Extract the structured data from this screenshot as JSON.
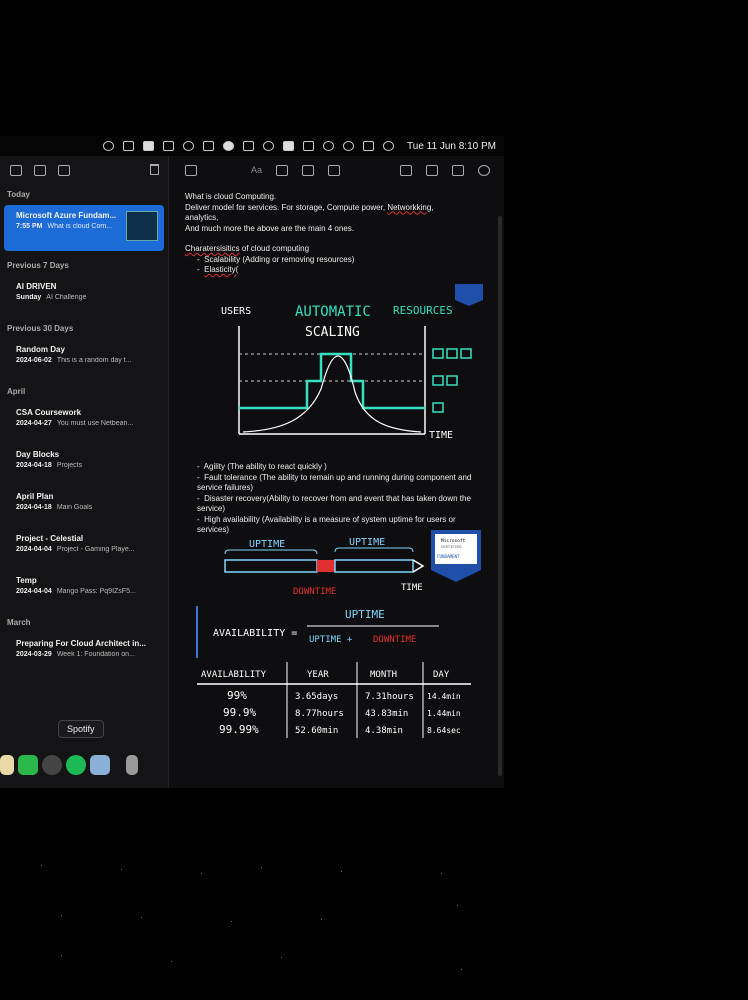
{
  "menubar": {
    "clock": "Tue 11 Jun  8:10 PM"
  },
  "sidebar": {
    "sections": [
      {
        "title": "Today",
        "notes": [
          {
            "title": "Microsoft Azure Fundam...",
            "date": "7:55 PM",
            "snippet": "What is cloud Com...",
            "active": true
          }
        ]
      },
      {
        "title": "Previous 7 Days",
        "notes": [
          {
            "title": "AI DRIVEN",
            "date": "Sunday",
            "snippet": "AI Challenge"
          }
        ]
      },
      {
        "title": "Previous 30 Days",
        "notes": [
          {
            "title": "Random Day",
            "date": "2024-06-02",
            "snippet": "This is a random day t..."
          }
        ]
      },
      {
        "title": "April",
        "notes": [
          {
            "title": "CSA Coursework",
            "date": "2024-04-27",
            "snippet": "You must use Netbean..."
          },
          {
            "title": "Day Blocks",
            "date": "2024-04-18",
            "snippet": "Projects"
          },
          {
            "title": "April Plan",
            "date": "2024-04-18",
            "snippet": "Main Goals"
          },
          {
            "title": "Project - Celestial",
            "date": "2024-04-04",
            "snippet": "Project - Gaming Playe..."
          },
          {
            "title": "Temp",
            "date": "2024-04-04",
            "snippet": "Mango Pass: Pq9IZsF5..."
          }
        ]
      },
      {
        "title": "March",
        "notes": [
          {
            "title": "Preparing For Cloud Architect in...",
            "date": "2024-03-29",
            "snippet": "Week 1: Foundation on..."
          }
        ]
      }
    ]
  },
  "tooltip": "Spotify",
  "editor": {
    "toolbar_text_style": "Aa",
    "lines1": [
      "What is cloud Computing.",
      "Deliver model for services. For storage, Compute power,",
      "Networkking,",
      "analytics,",
      "And much more the above are the main 4 ones."
    ],
    "characteristics_heading": "Charatersisitics",
    "characteristics_rest": " of cloud computing",
    "bullets1": [
      "Scalability (Adding or removing resources)",
      "Elasticity("
    ],
    "scaling": {
      "users": "USERS",
      "auto": "AUTOMATIC",
      "scaling": "SCALING",
      "resources": "RESOURCES",
      "time": "TIME"
    },
    "bullets2": [
      "Agility (The ability to react quickly )",
      "Fault tolerance (The ability to remain up and running during component and service failures)",
      "Disaster recovery(Ability to recover from and event that has taken down the service)",
      "High availability (Availability is a measure of system uptime for users or services)"
    ],
    "uptime": {
      "up1": "UPTIME",
      "up2": "UPTIME",
      "down": "DOWNTIME",
      "time": "TIME",
      "badge1": "Microsoft",
      "badge2": "CERTIFIED",
      "badge3": "FUNDAMENT"
    },
    "formula": {
      "lhs": "AVAILABILITY =",
      "num": "UPTIME",
      "den_a": "UPTIME +",
      "den_b": "DOWNTIME"
    },
    "table": {
      "headers": [
        "AVAILABILITY",
        "YEAR",
        "MONTH",
        "DAY"
      ],
      "rows": [
        [
          "99%",
          "3.65days",
          "7.31hours",
          "14.4min"
        ],
        [
          "99.9%",
          "8.77hours",
          "43.83min",
          "1.44min"
        ],
        [
          "99.99%",
          "52.60min",
          "4.38min",
          "8.64sec"
        ]
      ]
    }
  },
  "colors": {
    "accent": "#1c6bd6",
    "teal": "#35e0c0",
    "red": "#e23030",
    "cyan": "#7fd6ff"
  }
}
